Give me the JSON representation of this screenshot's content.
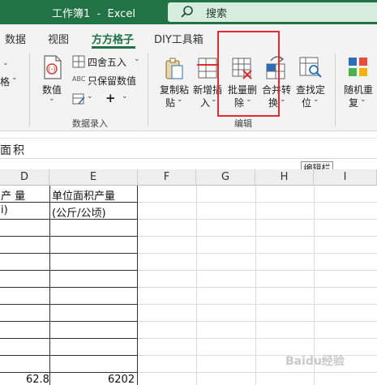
{
  "window": {
    "title": "工作簿1  -  Excel"
  },
  "search": {
    "label": "搜索"
  },
  "tabs": [
    {
      "label": "数据",
      "active": false
    },
    {
      "label": "视图",
      "active": false
    },
    {
      "label": "方方格子",
      "active": true
    },
    {
      "label": "DIY工具箱",
      "active": false
    }
  ],
  "ribbon": {
    "left_partial": "格",
    "value_button": "数值",
    "round_item": "四舍五入",
    "keep_value_item": "只保留数值",
    "abc_tag": "ABC",
    "group_data_entry": "数据录入",
    "buttons": [
      {
        "label1": "复制粘",
        "label2": "贴"
      },
      {
        "label1": "新增插",
        "label2": "入"
      },
      {
        "label1": "批量删",
        "label2": "除"
      },
      {
        "label1": "合并转",
        "label2": "换"
      },
      {
        "label1": "查找定",
        "label2": "位"
      },
      {
        "label1": "随机重",
        "label2": "复"
      }
    ],
    "group_edit": "编辑"
  },
  "formula_bar": {
    "content": "面积"
  },
  "tooltip": "编辑栏",
  "columns": [
    "D",
    "E",
    "F",
    "G",
    "H",
    "I"
  ],
  "cells": {
    "d_header": "产    量",
    "d_unit": "i)",
    "e_header": "单位面积产量",
    "e_unit": "(公斤/公顷)",
    "d_bottom": "62.8",
    "e_bottom": "6202"
  },
  "watermark": "Baidu经验",
  "colors": {
    "excel_green": "#217346",
    "highlight_red": "#e22b2b"
  }
}
